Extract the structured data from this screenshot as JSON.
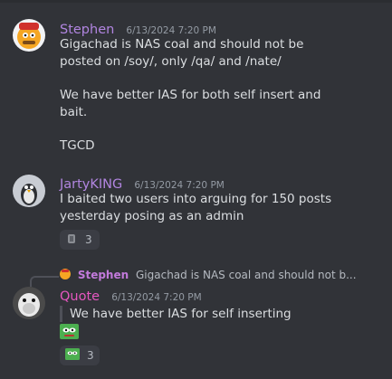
{
  "messages": [
    {
      "username": "Stephen",
      "username_color": "#b185e0",
      "timestamp": "6/13/2024 7:20 PM",
      "lines": [
        "Gigachad is NAS coal and should not be",
        "posted on /soy/, only /qa/ and /nate/",
        "",
        "We have better IAS for both self insert and",
        "bait.",
        "",
        "TGCD"
      ]
    },
    {
      "username": "JartyKING",
      "username_color": "#b185e0",
      "timestamp": "6/13/2024 7:20 PM",
      "lines": [
        "I baited two users into arguing for 150 posts",
        "yesterday posing as an admin"
      ],
      "reaction": {
        "icon": "hand-figure-icon",
        "count": "3"
      }
    },
    {
      "reply": {
        "username": "Stephen",
        "username_color": "#c27adb",
        "preview": "Gigachad is NAS coal and should not b..."
      },
      "username": "Quote",
      "username_color": "#e657c0",
      "timestamp": "6/13/2024 7:20 PM",
      "quote": "We have better IAS for self inserting",
      "emoji_name": "pepe-emoji",
      "reaction": {
        "icon": "pepe-icon",
        "count": "3"
      }
    }
  ]
}
